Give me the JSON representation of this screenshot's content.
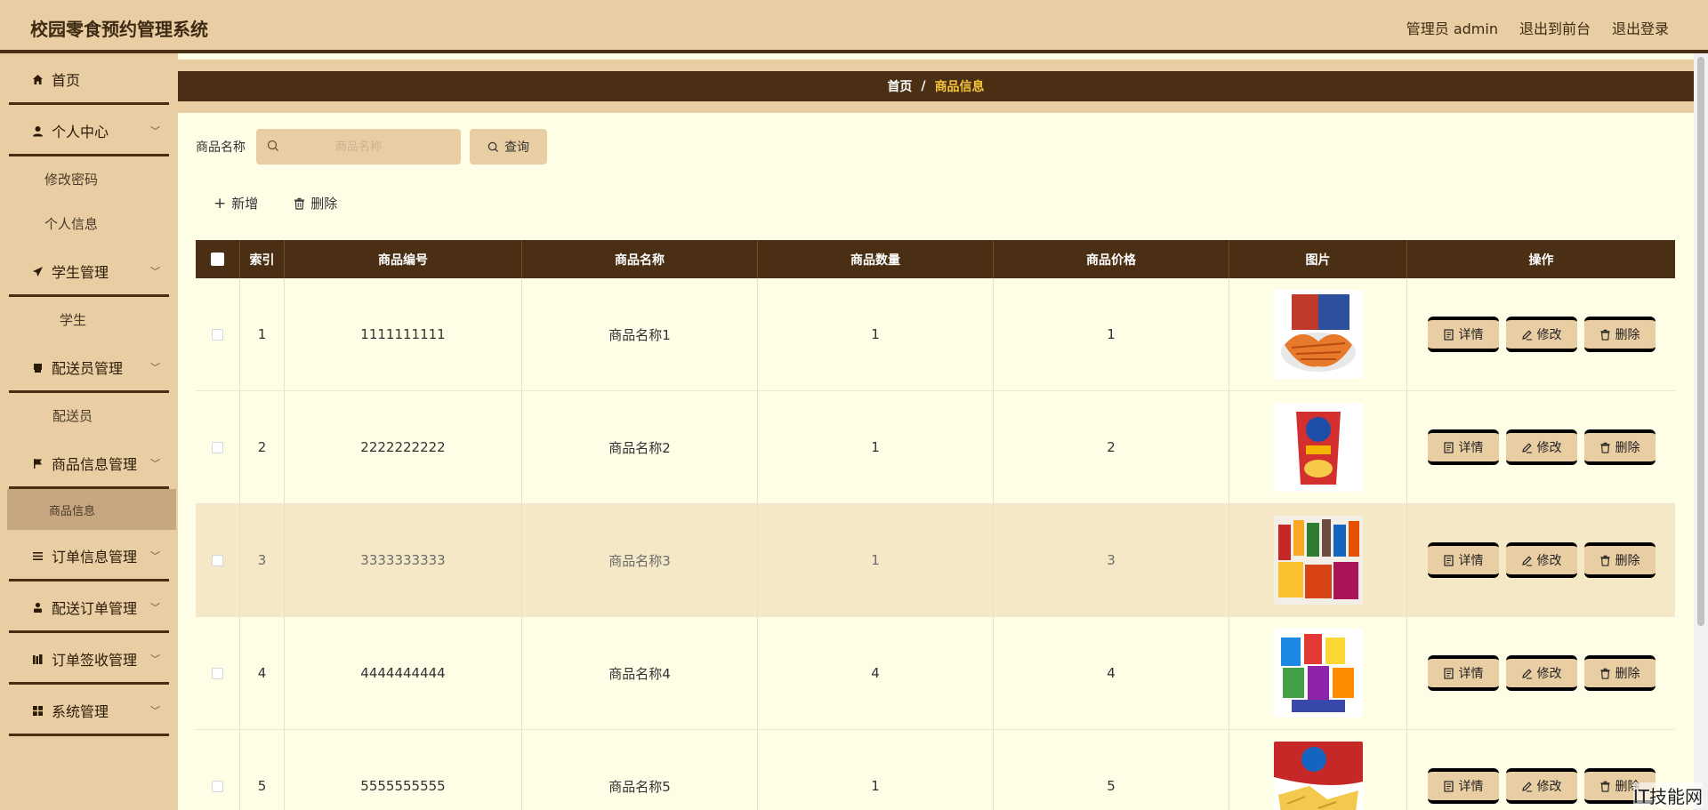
{
  "header": {
    "title": "校园零食预约管理系统",
    "user": "管理员 admin",
    "to_front": "退出到前台",
    "logout": "退出登录"
  },
  "sidebar": {
    "home": "首页",
    "personal": "个人中心",
    "change_password": "修改密码",
    "personal_info": "个人信息",
    "student_mgmt": "学生管理",
    "student": "学生",
    "courier_mgmt": "配送员管理",
    "courier": "配送员",
    "goods_mgmt": "商品信息管理",
    "goods_info": "商品信息",
    "order_mgmt": "订单信息管理",
    "delivery_order_mgmt": "配送订单管理",
    "receipt_mgmt": "订单签收管理",
    "system_mgmt": "系统管理"
  },
  "breadcrumb": {
    "home": "首页",
    "sep": "/",
    "current": "商品信息"
  },
  "search": {
    "label": "商品名称",
    "placeholder": "商品名称",
    "button": "查询"
  },
  "actions": {
    "add": "新增",
    "delete": "删除"
  },
  "table": {
    "headers": [
      "索引",
      "商品编号",
      "商品名称",
      "商品数量",
      "商品价格",
      "图片",
      "操作"
    ],
    "rows": [
      {
        "index": "1",
        "code": "1111111111",
        "name": "商品名称1",
        "qty": "1",
        "price": "1",
        "img": "spicy-strips"
      },
      {
        "index": "2",
        "code": "2222222222",
        "name": "商品名称2",
        "qty": "1",
        "price": "2",
        "img": "chips-bag"
      },
      {
        "index": "3",
        "code": "3333333333",
        "name": "商品名称3",
        "qty": "1",
        "price": "3",
        "img": "snack-pile"
      },
      {
        "index": "4",
        "code": "4444444444",
        "name": "商品名称4",
        "qty": "4",
        "price": "4",
        "img": "snack-pile-2"
      },
      {
        "index": "5",
        "code": "5555555555",
        "name": "商品名称5",
        "qty": "1",
        "price": "5",
        "img": "chips-red"
      }
    ],
    "op_detail": "详情",
    "op_edit": "修改",
    "op_delete": "删除"
  },
  "watermark": "IT技能网",
  "colors": {
    "accent": "#4a2f14",
    "panel": "#e9cda3",
    "background": "#fefde6",
    "breadcrumb_current": "#f5c33a"
  }
}
